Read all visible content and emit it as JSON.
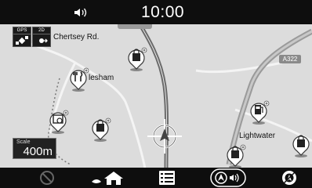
{
  "status_bar": {
    "time": "10:00",
    "volume_icon": "speaker-sound-icon"
  },
  "indicators": [
    {
      "label": "GPS",
      "icon": "satellite-icon"
    },
    {
      "label": "2D",
      "icon": "compass-arrow-icon"
    }
  ],
  "map": {
    "labels": {
      "road_1": "Chertsey Rd.",
      "road_2": "lesham",
      "road_3": "Lightwater",
      "road_sign": "A322"
    },
    "scale": {
      "title": "Scale",
      "value": "400m"
    },
    "pois": [
      {
        "icon": "shopping-bag-icon"
      },
      {
        "icon": "restaurant-icon"
      },
      {
        "icon": "post-office-icon"
      },
      {
        "icon": "shopping-bag-icon"
      },
      {
        "icon": "fuel-station-icon"
      },
      {
        "icon": "shopping-bag-icon"
      },
      {
        "icon": "shopping-bag-icon"
      }
    ],
    "colors": {
      "background": "#dcdcdc",
      "main_road": "#9a9a9a",
      "minor_road": "#ffffff",
      "route_track": "#6a6a6a",
      "cursor": "#ffffff"
    }
  },
  "bottom_bar": {
    "buttons": [
      {
        "icon": "cancel-route-icon"
      },
      {
        "icon": "home-icon"
      },
      {
        "icon": "list-menu-icon"
      },
      {
        "icon": "voice-guidance-icon"
      },
      {
        "icon": "map-view-icon"
      }
    ]
  }
}
